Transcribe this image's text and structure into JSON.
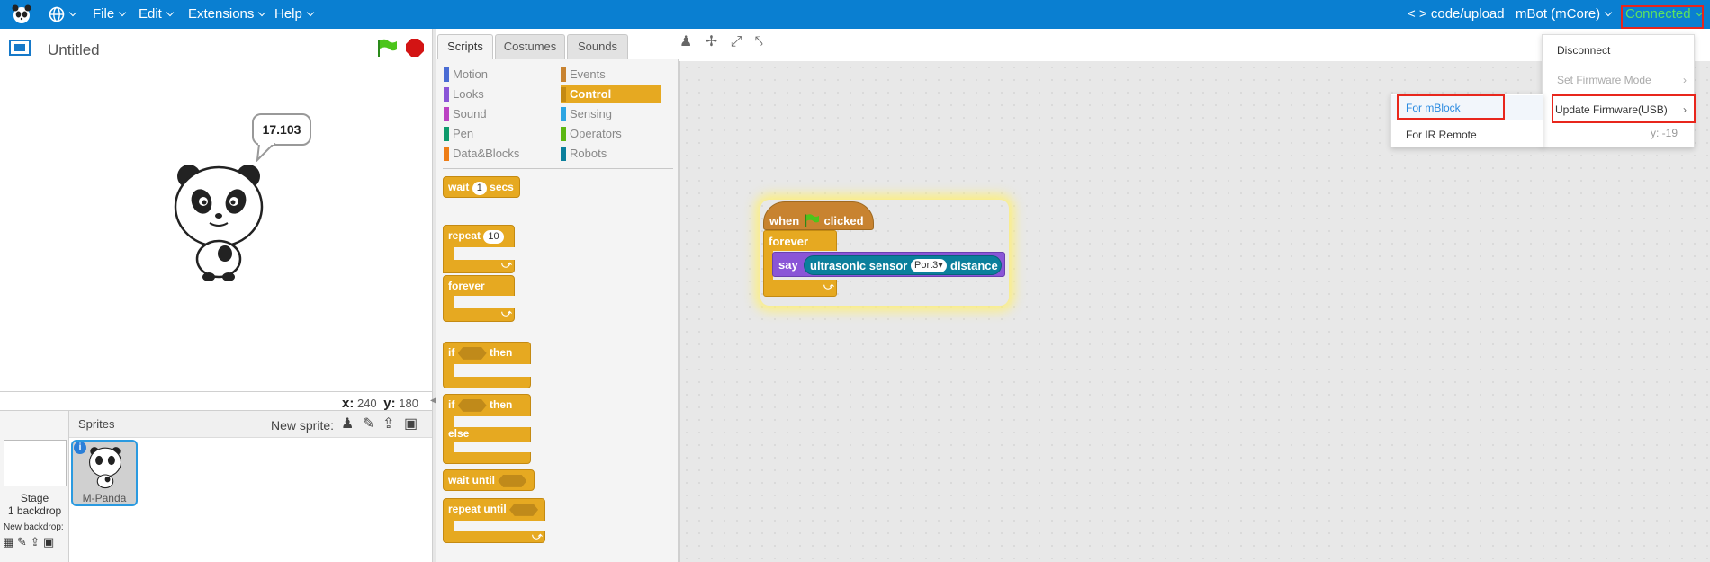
{
  "menubar": {
    "file": "File",
    "edit": "Edit",
    "extensions": "Extensions",
    "help": "Help",
    "code_upload": "< > code/upload",
    "board": "mBot (mCore)",
    "connection": "Connected"
  },
  "stage": {
    "title": "Untitled",
    "speech": "17.103",
    "x_label": "x:",
    "x_value": "240",
    "y_label": "y:",
    "y_value": "180"
  },
  "sprites": {
    "header": "Sprites",
    "new_sprite": "New sprite:",
    "stage_label": "Stage",
    "backdrop_count": "1 backdrop",
    "new_backdrop": "New backdrop:",
    "sprite_name": "M-Panda"
  },
  "tabs": [
    "Scripts",
    "Costumes",
    "Sounds"
  ],
  "categories": [
    {
      "label": "Motion",
      "color": "#4a6cd4"
    },
    {
      "label": "Events",
      "color": "#c88330"
    },
    {
      "label": "Looks",
      "color": "#8a55d7"
    },
    {
      "label": "Control",
      "color": "#e1a91a"
    },
    {
      "label": "Sound",
      "color": "#bb42c3"
    },
    {
      "label": "Sensing",
      "color": "#2ca5e2"
    },
    {
      "label": "Pen",
      "color": "#0e9a6c"
    },
    {
      "label": "Operators",
      "color": "#5cb712"
    },
    {
      "label": "Data&Blocks",
      "color": "#ee7d16"
    },
    {
      "label": "Robots",
      "color": "#0b7f9c"
    }
  ],
  "palette_blocks": {
    "wait": "wait",
    "wait_value": "1",
    "secs": "secs",
    "repeat": "repeat",
    "repeat_value": "10",
    "forever": "forever",
    "if": "if",
    "then": "then",
    "if2": "if",
    "then2": "then",
    "else": "else",
    "wait_until": "wait until",
    "repeat_until": "repeat until"
  },
  "script": {
    "when": "when",
    "clicked": "clicked",
    "forever": "forever",
    "say": "say",
    "sensor": "ultrasonic sensor",
    "port": "Port3",
    "distance": "distance"
  },
  "connect_menu": {
    "disconnect": "Disconnect",
    "set_firmware": "Set Firmware Mode",
    "update_firmware": "Update Firmware(USB)",
    "y_readout": "y: -19"
  },
  "firmware_submenu": {
    "for_mblock": "For mBlock",
    "for_ir_remote": "For IR Remote"
  },
  "colors": {
    "menubar": "#0a7fd1",
    "control": "#e6a921",
    "highlight": "#e8261c",
    "connected": "#5ee25e",
    "robots": "#0b7f9c",
    "looks": "#8a55d7"
  }
}
